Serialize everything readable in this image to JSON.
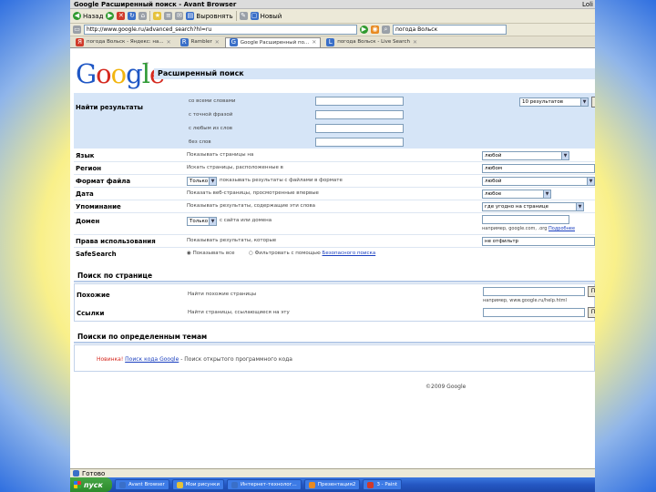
{
  "browser": {
    "title": "Google Расширенный поиск - Avant Browser",
    "title_right": "Loli",
    "nav": {
      "back": "Назад",
      "print": "Выровнять",
      "new": "Новый"
    },
    "address": "http://www.google.ru/advanced_search?hl=ru",
    "search_value": "погода Вольск",
    "tabs": [
      "погода Вольск - Яндекс: на...",
      "Rambler",
      "Google Расширенный по...",
      "погода Вольск - Live Search"
    ],
    "status": "Готово"
  },
  "page": {
    "logo_letters": [
      "G",
      "o",
      "o",
      "g",
      "l",
      "e"
    ],
    "logo_tm": "™",
    "title": "Расширенный поиск",
    "find_results": "Найти результаты",
    "words": [
      "со всеми словами",
      "с точной фразой",
      "с любым из слов",
      "без слов"
    ],
    "results_count": "10 результатов",
    "search_button": "П",
    "rows": [
      {
        "label": "Язык",
        "desc": "Показывать страницы на",
        "value": "любой"
      },
      {
        "label": "Регион",
        "desc": "Искать страницы, расположенные в",
        "value": "любом"
      },
      {
        "label": "Формат файла",
        "only": "Только",
        "desc": "показывать результаты с файлами в формате",
        "value": "любой"
      },
      {
        "label": "Дата",
        "desc": "Показать веб-страницы, просмотренные впервые",
        "value": "любое"
      },
      {
        "label": "Упоминание",
        "desc": "Показывать результаты, содержащие эти слова",
        "value": "где угодно на странице"
      },
      {
        "label": "Домен",
        "only": "Только",
        "desc": "с сайта или домена",
        "value": ""
      },
      {
        "label": "Права использования",
        "desc": "Показывать результаты, которые",
        "value": "не отфильтр"
      }
    ],
    "domain_hint": "например, google.com, .org",
    "domain_hint_link": "Подробнее",
    "safesearch_label": "SafeSearch",
    "safe_off": "Показывать все",
    "safe_on": "Фильтровать с помощью",
    "safe_link": "Безопасного поиска",
    "page_search_title": "Поиск по странице",
    "similar_label": "Похожие",
    "similar_desc": "Найти похожие страницы",
    "similar_hint": "например, www.google.ru/help.html",
    "links_label": "Ссылки",
    "links_desc": "Найти страницы, ссылающиеся на эту",
    "topics_title": "Поиски по определенным темам",
    "new_label": "Новинка!",
    "code_link": "Поиск кода Google",
    "code_desc": "- Поиск открытого программного кода",
    "copyright": "©2009 Google"
  },
  "taskbar": {
    "start": "пуск",
    "items": [
      "Avant Browser",
      "Мои рисунки",
      "Интернет-технолог...",
      "Презентация2",
      "3 - Paint"
    ]
  },
  "colors": {
    "section_bg": "#d6e5f7",
    "taskbar": "#2457c2",
    "start": "#2c8a2c"
  }
}
